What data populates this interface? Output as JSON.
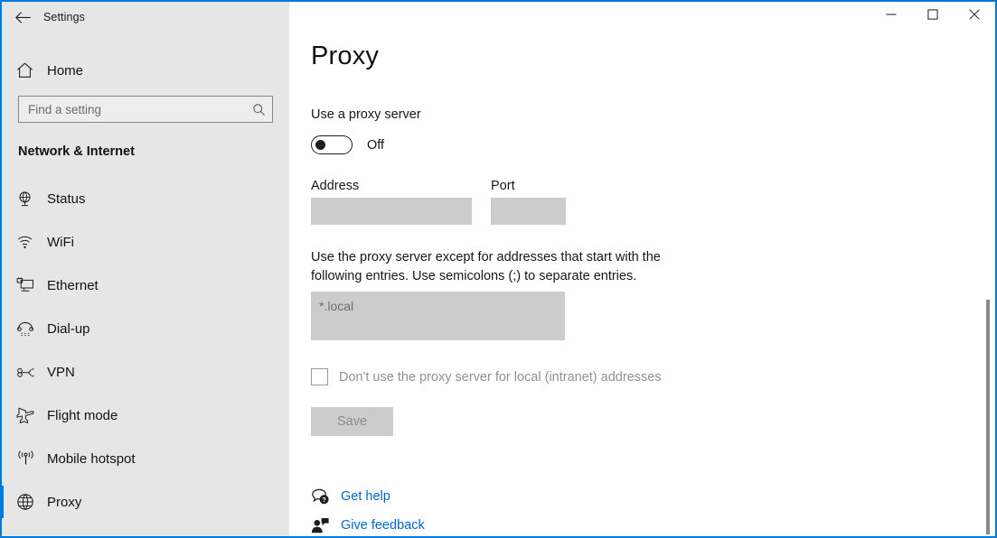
{
  "window": {
    "title": "Settings",
    "accent_color": "#0078d7",
    "sidebar_bg": "#e6e6e6",
    "back_icon": "back-arrow-icon",
    "controls": {
      "minimize": "minimize-icon",
      "maximize": "maximize-icon",
      "close": "close-icon"
    }
  },
  "sidebar": {
    "home": {
      "label": "Home",
      "icon": "home-icon"
    },
    "search": {
      "placeholder": "Find a setting",
      "value": "",
      "icon": "search-icon"
    },
    "section_header": "Network & Internet",
    "items": [
      {
        "label": "Status",
        "icon": "globe-monitor-icon",
        "selected": false
      },
      {
        "label": "WiFi",
        "icon": "wifi-icon",
        "selected": false
      },
      {
        "label": "Ethernet",
        "icon": "ethernet-icon",
        "selected": false
      },
      {
        "label": "Dial-up",
        "icon": "dialup-phone-icon",
        "selected": false
      },
      {
        "label": "VPN",
        "icon": "vpn-key-icon",
        "selected": false
      },
      {
        "label": "Flight mode",
        "icon": "airplane-icon",
        "selected": false
      },
      {
        "label": "Mobile hotspot",
        "icon": "hotspot-icon",
        "selected": false
      },
      {
        "label": "Proxy",
        "icon": "globe-icon",
        "selected": true
      }
    ]
  },
  "main": {
    "page_title": "Proxy",
    "use_proxy": {
      "label": "Use a proxy server",
      "state_label": "Off",
      "checked": false
    },
    "address": {
      "label": "Address",
      "value": "",
      "placeholder": ""
    },
    "port": {
      "label": "Port",
      "value": "",
      "placeholder": ""
    },
    "bypass": {
      "description": "Use the proxy server except for addresses that start with the following entries. Use semicolons (;) to separate entries.",
      "value": "",
      "placeholder": "*.local"
    },
    "local_bypass_checkbox": {
      "label": "Don't use the proxy server for local (intranet) addresses",
      "checked": false,
      "disabled": true
    },
    "save_button": {
      "label": "Save",
      "disabled": true
    },
    "links": [
      {
        "label": "Get help",
        "icon": "help-bubble-icon",
        "color": "#0066cc"
      },
      {
        "label": "Give feedback",
        "icon": "feedback-person-icon",
        "color": "#0066cc"
      }
    ]
  }
}
